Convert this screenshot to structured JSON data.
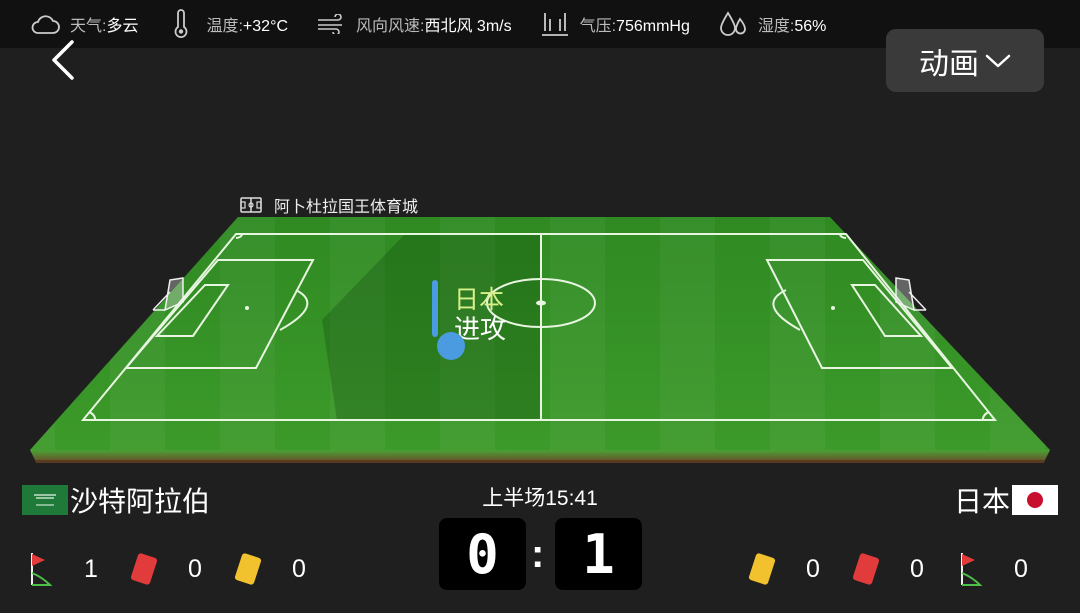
{
  "weather": {
    "condition_label": "天气:",
    "condition_value": "多云",
    "temperature_label": "温度:",
    "temperature_value": "+32°C",
    "wind_label": "风向风速:",
    "wind_value": "西北风 3m/s",
    "pressure_label": "气压:",
    "pressure_value": "756mmHg",
    "humidity_label": "湿度:",
    "humidity_value": "56%"
  },
  "header": {
    "animation_label": "动画"
  },
  "stadium": {
    "name": "阿卜杜拉国王体育城"
  },
  "attack": {
    "team": "日本",
    "action": "进攻"
  },
  "match": {
    "period_time": "上半场15:41",
    "home": {
      "name": "沙特阿拉伯",
      "score": "0",
      "corners": "1",
      "red_cards": "0",
      "yellow_cards": "0",
      "flag_icon": "saudi-arabia-flag-icon"
    },
    "away": {
      "name": "日本",
      "score": "1",
      "yellow_cards": "0",
      "red_cards": "0",
      "corners": "0",
      "flag_icon": "japan-flag-icon"
    },
    "separator": ":"
  },
  "colors": {
    "accent_blue": "#4a9be0",
    "team_highlight": "#d8f08a",
    "red_card": "#e23b3b",
    "yellow_card": "#f2c12e",
    "pitch_green": "#3f9a2c"
  }
}
